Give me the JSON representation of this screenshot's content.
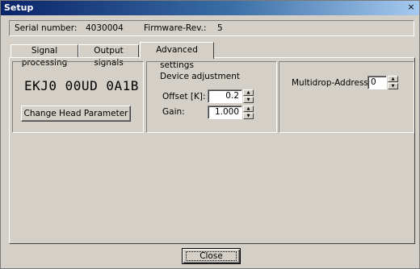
{
  "window": {
    "title": "Setup",
    "close_glyph": "×"
  },
  "info": {
    "serial_label": "Serial number:",
    "serial_value": "4030004",
    "firmware_label": "Firmware-Rev.:",
    "firmware_value": "5"
  },
  "tabs": [
    {
      "label": "Signal processing",
      "active": false
    },
    {
      "label": "Output signals",
      "active": false
    },
    {
      "label": "Advanced settings",
      "active": true
    }
  ],
  "head": {
    "code": "EKJ0 00UD 0A1B",
    "button_label": "Change Head Parameter"
  },
  "device_adjustment": {
    "title": "Device adjustment",
    "offset_label": "Offset [K]:",
    "offset_value": "0.2",
    "gain_label": "Gain:",
    "gain_value": "1.000"
  },
  "multidrop": {
    "label": "Multidrop-Address:",
    "value": "0"
  },
  "footer": {
    "close_label": "Close"
  },
  "icons": {
    "spin_up": "▲",
    "spin_down": "▼"
  }
}
